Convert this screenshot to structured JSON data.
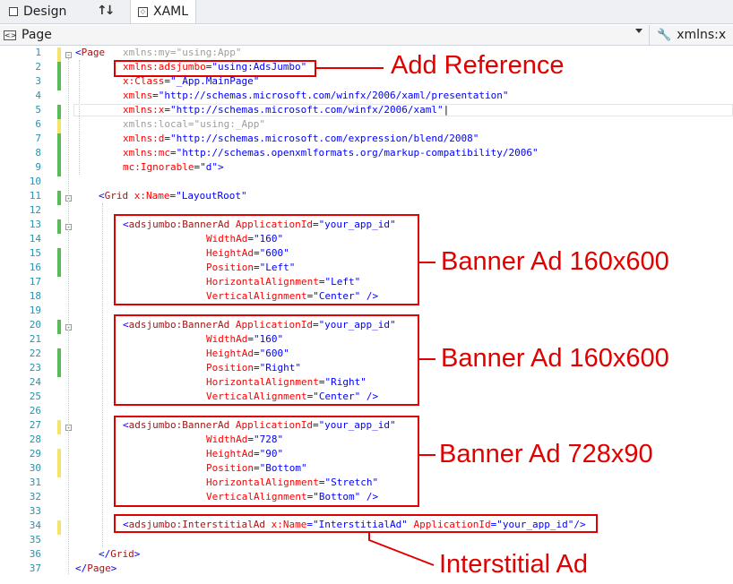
{
  "tabs": {
    "design": "Design",
    "xaml": "XAML"
  },
  "navbar": {
    "scope": "Page",
    "member": "xmlns:x"
  },
  "line_numbers": [
    "1",
    "2",
    "3",
    "4",
    "5",
    "6",
    "7",
    "8",
    "9",
    "10",
    "11",
    "12",
    "13",
    "14",
    "15",
    "16",
    "17",
    "18",
    "19",
    "20",
    "21",
    "22",
    "23",
    "24",
    "25",
    "26",
    "27",
    "28",
    "29",
    "30",
    "31",
    "32",
    "33",
    "34",
    "35",
    "36",
    "37"
  ],
  "code": {
    "l1": "<Page   xmlns:my=\"using:App\"",
    "l2": "xmlns:adsjumbo=\"using:AdsJumbo\"",
    "l3": "x:Class=\"_App.MainPage\"",
    "l4": "xmlns=\"http://schemas.microsoft.com/winfx/2006/xaml/presentation\"",
    "l5": "xmlns:x=\"http://schemas.microsoft.com/winfx/2006/xaml\"",
    "l6": "xmlns:local=\"using:_App\"",
    "l7": "xmlns:d=\"http://schemas.microsoft.com/expression/blend/2008\"",
    "l8": "xmlns:mc=\"http://schemas.openxmlformats.org/markup-compatibility/2006\"",
    "l9": "mc:Ignorable=\"d\">",
    "l11": "<Grid x:Name=\"LayoutRoot\"",
    "l13": "<adsjumbo:BannerAd ApplicationId=\"your_app_id\"",
    "l14": "WidthAd=\"160\"",
    "l15": "HeightAd=\"600\"",
    "l16": "Position=\"Left\"",
    "l17": "HorizontalAlignment=\"Left\"",
    "l18": "VerticalAlignment=\"Center\" />",
    "l20": "<adsjumbo:BannerAd ApplicationId=\"your_app_id\"",
    "l21": "WidthAd=\"160\"",
    "l22": "HeightAd=\"600\"",
    "l23": "Position=\"Right\"",
    "l24": "HorizontalAlignment=\"Right\"",
    "l25": "VerticalAlignment=\"Center\" />",
    "l27": "<adsjumbo:BannerAd ApplicationId=\"your_app_id\"",
    "l28": "WidthAd=\"728\"",
    "l29": "HeightAd=\"90\"",
    "l30": "Position=\"Bottom\"",
    "l31": "HorizontalAlignment=\"Stretch\"",
    "l32": "VerticalAlignment=\"Bottom\" />",
    "l34": "<adsjumbo:InterstitialAd x:Name=\"InterstitialAd\" ApplicationId=\"your_app_id\"/>",
    "l36": "</Grid>",
    "l37": "</Page>"
  },
  "annotations": {
    "add_reference": "Add Reference",
    "banner1": "Banner Ad 160x600",
    "banner2": "Banner Ad 160x600",
    "banner3": "Banner Ad 728x90",
    "interstitial": "Interstitial Ad"
  },
  "colors": {
    "annotation": "#e00000",
    "tag": "#a31515",
    "attribute": "#ff0000",
    "value": "#0000ff",
    "line_number": "#2b91af",
    "changed_saved": "#57bb57",
    "changed_unsaved": "#f3e46a"
  }
}
